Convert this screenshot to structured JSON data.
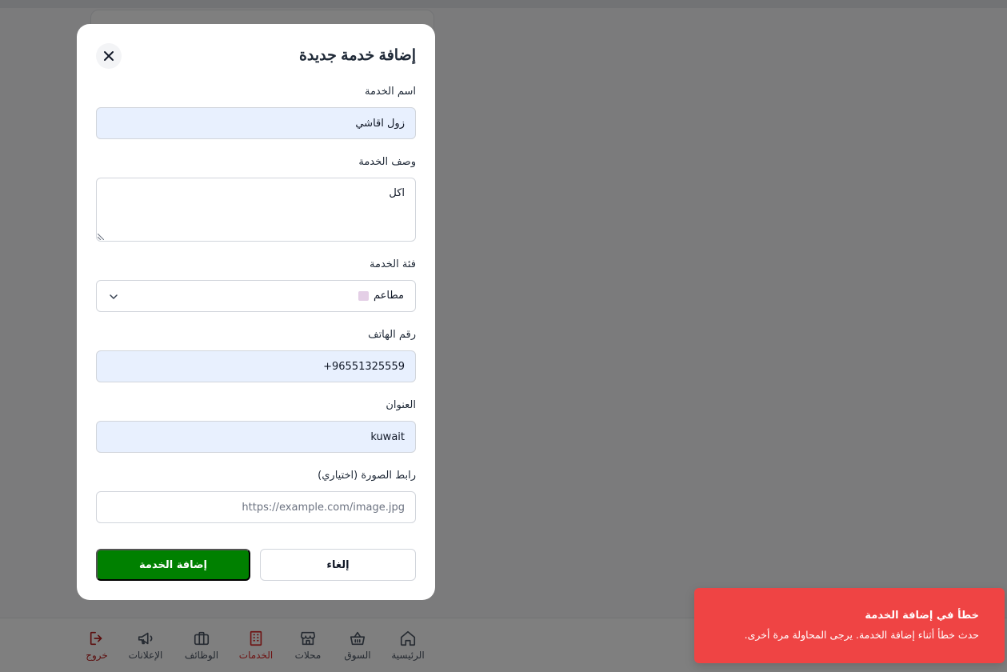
{
  "modal": {
    "title": "إضافة خدمة جديدة",
    "fields": {
      "name": {
        "label": "اسم الخدمة",
        "value": "زول اقاشي"
      },
      "description": {
        "label": "وصف الخدمة",
        "value": "اكل"
      },
      "category": {
        "label": "فئة الخدمة",
        "value": "مطاعم"
      },
      "phone": {
        "label": "رقم الهاتف",
        "value": "+96551325559"
      },
      "address": {
        "label": "العنوان",
        "value": "kuwait"
      },
      "image": {
        "label": "رابط الصورة (اختياري)",
        "placeholder": "https://example.com/image.jpg"
      }
    },
    "buttons": {
      "cancel": "إلغاء",
      "submit": "إضافة الخدمة"
    }
  },
  "bottom_nav": {
    "home": "الرئيسية",
    "market": "السوق",
    "shops": "محلات",
    "services": "الخدمات",
    "jobs": "الوظائف",
    "ads": "الإعلانات",
    "logout": "خروج"
  },
  "toast": {
    "title": "خطأ في إضافة الخدمة",
    "message": "حدث خطأ أثناء إضافة الخدمة. يرجى المحاولة مرة أخرى."
  },
  "colors": {
    "submit": "#008000",
    "toast": "#ef4444",
    "active_nav": "#dc2626",
    "filled_input": "#e8f0fe"
  }
}
